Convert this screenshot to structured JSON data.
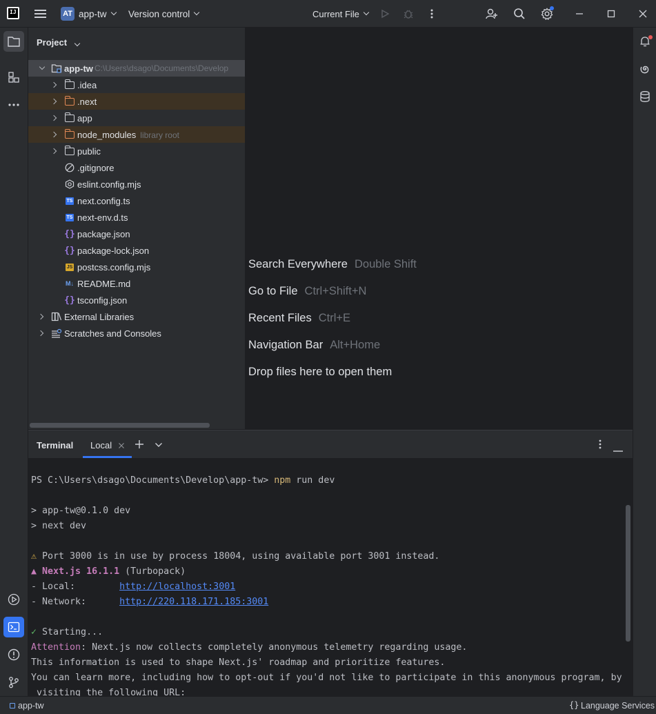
{
  "titlebar": {
    "project_badge": "AT",
    "project_name": "app-tw",
    "version_control": "Version control",
    "run_config": "Current File"
  },
  "project_panel": {
    "title": "Project",
    "root": {
      "name": "app-tw",
      "path": "C:\\Users\\dsago\\Documents\\Develop"
    },
    "items": [
      {
        "label": ".idea",
        "type": "folder"
      },
      {
        "label": ".next",
        "type": "folder-excluded"
      },
      {
        "label": "app",
        "type": "folder"
      },
      {
        "label": "node_modules",
        "type": "folder-excluded",
        "hint": "library root"
      },
      {
        "label": "public",
        "type": "folder"
      },
      {
        "label": ".gitignore",
        "type": "ignore-file"
      },
      {
        "label": "eslint.config.mjs",
        "type": "eslint-file"
      },
      {
        "label": "next.config.ts",
        "type": "ts-file"
      },
      {
        "label": "next-env.d.ts",
        "type": "ts-file"
      },
      {
        "label": "package.json",
        "type": "json-file"
      },
      {
        "label": "package-lock.json",
        "type": "json-file"
      },
      {
        "label": "postcss.config.mjs",
        "type": "js-file"
      },
      {
        "label": "README.md",
        "type": "md-file"
      },
      {
        "label": "tsconfig.json",
        "type": "json-file"
      }
    ],
    "external_libraries": "External Libraries",
    "scratches": "Scratches and Consoles"
  },
  "editor_hints": [
    {
      "label": "Search Everywhere",
      "shortcut": "Double Shift"
    },
    {
      "label": "Go to File",
      "shortcut": "Ctrl+Shift+N"
    },
    {
      "label": "Recent Files",
      "shortcut": "Ctrl+E"
    },
    {
      "label": "Navigation Bar",
      "shortcut": "Alt+Home"
    },
    {
      "label": "Drop files here to open them",
      "shortcut": ""
    }
  ],
  "terminal": {
    "title": "Terminal",
    "tab": "Local",
    "prompt": "PS C:\\Users\\dsago\\Documents\\Develop\\app-tw> ",
    "command": "npm",
    "command_args": " run dev",
    "line_script1": "> app-tw@0.1.0 dev",
    "line_script2": "> next dev",
    "warn_glyph": "⚠",
    "warn_text": " Port 3000 is in use by process 18004, using available port 3001 instead.",
    "next_glyph": "▲",
    "next_name": " Next.js 16.1.1",
    "next_suffix": " (Turbopack)",
    "local_label": "- Local:        ",
    "local_url": "http://localhost:3001",
    "network_label": "- Network:      ",
    "network_url": "http://220.118.171.185:3001",
    "check_glyph": "✓",
    "starting": " Starting...",
    "attention_label": "Attention",
    "attention_text": ": Next.js now collects completely anonymous telemetry regarding usage.",
    "info_line1": "This information is used to shape Next.js' roadmap and prioritize features.",
    "info_line2": "You can learn more, including how to opt-out if you'd not like to participate in this anonymous program, by",
    "info_line3": " visiting the following URL:"
  },
  "statusbar": {
    "project": "app-tw",
    "language_services": "Language Services"
  },
  "colors": {
    "accent": "#3574f0",
    "background": "#1e1f22",
    "panel": "#2b2d30",
    "excluded_folder": "#e08855"
  }
}
